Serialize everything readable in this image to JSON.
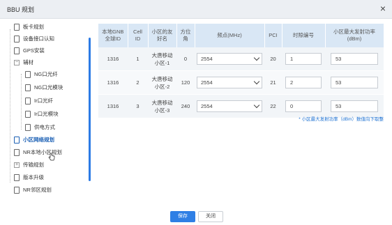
{
  "window": {
    "title": "BBU 规划",
    "close_glyph": "×"
  },
  "tree": {
    "items": [
      {
        "label": "板卡规划",
        "type": "leaf",
        "level": 1
      },
      {
        "label": "设备接口认知",
        "type": "leaf",
        "level": 1
      },
      {
        "label": "GPS安装",
        "type": "leaf",
        "level": 1
      },
      {
        "label": "辅材",
        "type": "folder",
        "expanded": true,
        "level": 1
      },
      {
        "label": "NG口光纤",
        "type": "leaf",
        "level": 2
      },
      {
        "label": "NG口光模块",
        "type": "leaf",
        "level": 2
      },
      {
        "label": "Ir口光纤",
        "type": "leaf",
        "level": 2
      },
      {
        "label": "Ir口光模块",
        "type": "leaf",
        "level": 2
      },
      {
        "label": "供电方式",
        "type": "leaf",
        "level": 2
      },
      {
        "label": "小区网络规划",
        "type": "leaf",
        "level": 1,
        "active": true
      },
      {
        "label": "NR本地小区规划",
        "type": "leaf",
        "level": 1
      },
      {
        "label": "传输规划",
        "type": "folder",
        "expanded": false,
        "level": 1
      },
      {
        "label": "版本升级",
        "type": "leaf",
        "level": 1
      },
      {
        "label": "NR邻区规划",
        "type": "leaf",
        "level": 1
      }
    ]
  },
  "table": {
    "headers": [
      [
        "本地GNB",
        "全球ID"
      ],
      [
        "Cell",
        "ID"
      ],
      [
        "小区的友",
        "好名"
      ],
      [
        "方位",
        "角"
      ],
      [
        "频点(MHz)"
      ],
      [
        "PCI"
      ],
      [
        "时隙编号"
      ],
      [
        "小区最大发射功率",
        "(dBm)"
      ]
    ],
    "rows": [
      {
        "gnb": "1316",
        "cell": "1",
        "name": [
          "大唐移动",
          "小区-1"
        ],
        "azimuth": "0",
        "freq": "2554",
        "pci": "20",
        "slot": "1",
        "power": "53"
      },
      {
        "gnb": "1316",
        "cell": "2",
        "name": [
          "大唐移动",
          "小区-2"
        ],
        "azimuth": "120",
        "freq": "2554",
        "pci": "21",
        "slot": "2",
        "power": "53"
      },
      {
        "gnb": "1316",
        "cell": "3",
        "name": [
          "大唐移动",
          "小区-3"
        ],
        "azimuth": "240",
        "freq": "2554",
        "pci": "22",
        "slot": "0",
        "power": "53"
      }
    ]
  },
  "note": "* 小区最大发射功率（dBm）数值向下取整",
  "footer": {
    "save_label": "保存",
    "close_label": "关闭"
  },
  "colors": {
    "accent": "#2f7fe5",
    "header_bg": "#d9e7f5",
    "active_node": "#1a5fb4"
  }
}
